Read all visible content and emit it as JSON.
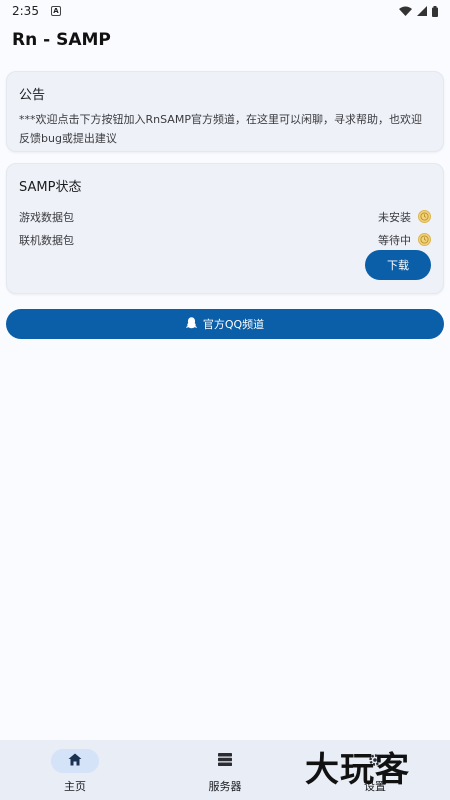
{
  "status_bar": {
    "time": "2:35",
    "badge": "A"
  },
  "app_bar": {
    "title": "Rn - SAMP"
  },
  "notice": {
    "title": "公告",
    "body": "***欢迎点击下方按钮加入RnSAMP官方频道，在这里可以闲聊，寻求帮助，也欢迎反馈bug或提出建议"
  },
  "samp_status": {
    "title": "SAMP状态",
    "rows": [
      {
        "label": "游戏数据包",
        "value": "未安装",
        "icon": "clock-icon"
      },
      {
        "label": "联机数据包",
        "value": "等待中",
        "icon": "clock-icon"
      }
    ],
    "download_label": "下载"
  },
  "qq_button": {
    "label": "官方QQ频道",
    "icon": "qq-penguin-icon"
  },
  "bottom_nav": {
    "items": [
      {
        "label": "主页",
        "icon": "home-icon",
        "active": true
      },
      {
        "label": "服务器",
        "icon": "server-list-icon",
        "active": false
      },
      {
        "label": "设置",
        "icon": "gear-icon",
        "active": false
      }
    ]
  },
  "watermark": {
    "text": "大玩客"
  },
  "colors": {
    "primary": "#0b5ea8",
    "card_bg": "#eef1f7",
    "nav_bg": "#e8edf6",
    "pending": "#f2d27a"
  }
}
